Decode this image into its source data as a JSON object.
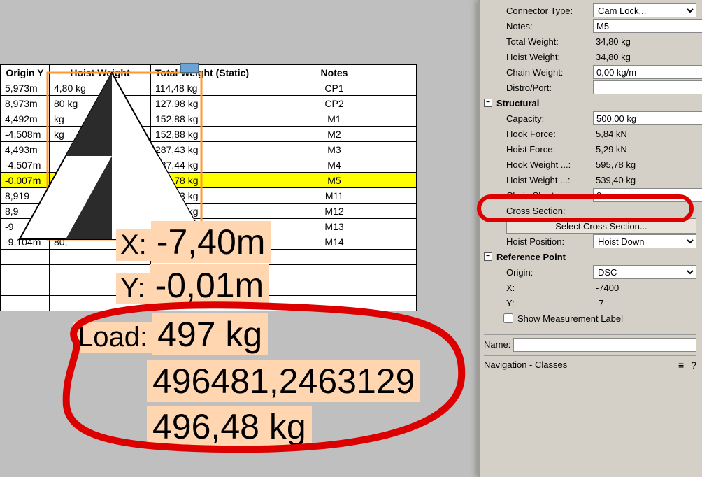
{
  "table": {
    "headers": {
      "oy": "Origin Y",
      "hw": "Hoist Weight",
      "tw": "Total Weight (Static)",
      "notes": "Notes"
    },
    "rows": [
      {
        "oy": "5,973m",
        "hw": "4,80 kg",
        "tw": "114,48 kg",
        "notes": "CP1",
        "hl": false
      },
      {
        "oy": "8,973m",
        "hw": "80 kg",
        "tw": "127,98 kg",
        "notes": "CP2",
        "hl": false
      },
      {
        "oy": "4,492m",
        "hw": "kg",
        "tw": "152,88 kg",
        "notes": "M1",
        "hl": false
      },
      {
        "oy": "-4,508m",
        "hw": "kg",
        "tw": "152,88 kg",
        "notes": "M2",
        "hl": false
      },
      {
        "oy": "4,493m",
        "hw": "",
        "tw": "287,43 kg",
        "notes": "M3",
        "hl": false
      },
      {
        "oy": "-4,507m",
        "hw": "",
        "tw": "287,44 kg",
        "notes": "M4",
        "hl": false
      },
      {
        "oy": "-0,007m",
        "hw": "",
        "tw": "595,78 kg",
        "notes": "M5",
        "hl": true
      },
      {
        "oy": "8,919",
        "hw": "",
        "tw": "981,13 kg",
        "notes": "M11",
        "hl": false
      },
      {
        "oy": "8,9",
        "hw": "",
        "tw": "531,13 kg",
        "notes": "M12",
        "hl": false
      },
      {
        "oy": "-9",
        "hw": "",
        "tw": "",
        "notes": "M13",
        "hl": false
      },
      {
        "oy": "-9,104m",
        "hw": "80,",
        "tw": "",
        "notes": "M14",
        "hl": false
      },
      {
        "oy": "",
        "hw": "",
        "tw": "",
        "notes": "",
        "hl": false
      },
      {
        "oy": "",
        "hw": "",
        "tw": "",
        "notes": "",
        "hl": false
      },
      {
        "oy": "",
        "hw": "",
        "tw": "",
        "notes": "",
        "hl": false
      },
      {
        "oy": "",
        "hw": "",
        "tw": "",
        "notes": "",
        "hl": false
      }
    ]
  },
  "overlay": {
    "x_label": "X:",
    "x_val": "-7,40m",
    "y_label": "Y:",
    "y_val": "-0,01m",
    "load_label": "Load:",
    "load_val": "497 kg",
    "long_num": "496481,2463129",
    "load_kg": "496,48 kg"
  },
  "panel": {
    "connector_type_label": "Connector Type:",
    "connector_type_value": "Cam Lock...",
    "notes_label": "Notes:",
    "notes_value": "M5",
    "total_weight_label": "Total Weight:",
    "total_weight_value": "34,80 kg",
    "hoist_weight_label": "Hoist Weight:",
    "hoist_weight_value": "34,80 kg",
    "chain_weight_label": "Chain Weight:",
    "chain_weight_value": "0,00 kg/m",
    "distro_label": "Distro/Port:",
    "distro_value": "",
    "section_structural": "Structural",
    "capacity_label": "Capacity:",
    "capacity_value": "500,00 kg",
    "hook_force_label": "Hook Force:",
    "hook_force_value": "5,84 kN",
    "hoist_force_label": "Hoist Force:",
    "hoist_force_value": "5,29 kN",
    "hook_weight_label": "Hook Weight ...:",
    "hook_weight_value": "595,78 kg",
    "hoist_weight2_label": "Hoist Weight ...:",
    "hoist_weight2_value": "539,40 kg",
    "chain_shorten_label": "Chain Shorten:",
    "chain_shorten_value": "0",
    "cross_section_label": "Cross Section:",
    "cross_section_btn": "Select Cross Section...",
    "hoist_position_label": "Hoist Position:",
    "hoist_position_value": "Hoist Down",
    "section_refpoint": "Reference Point",
    "origin_label": "Origin:",
    "origin_value": "DSC",
    "x_label": "X:",
    "x_value": "-7400",
    "y_label": "Y:",
    "y_value": "-7",
    "show_meas_label": "Show Measurement Label",
    "name_label": "Name:",
    "name_value": "",
    "nav_label": "Navigation - Classes",
    "menu_icon": "≡",
    "help_icon": "?"
  }
}
